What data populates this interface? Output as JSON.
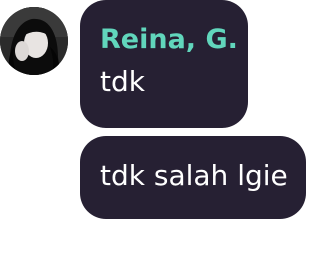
{
  "chat": {
    "avatar_icon": "user-avatar-photo",
    "sender": {
      "name": "Reina, G."
    },
    "messages": [
      {
        "text": "tdk"
      },
      {
        "text": "tdk salah lgie"
      }
    ]
  },
  "colors": {
    "bubble_bg": "#262033",
    "sender_name": "#61d6bc",
    "message_text": "#ffffff",
    "page_bg": "#ffffff"
  }
}
